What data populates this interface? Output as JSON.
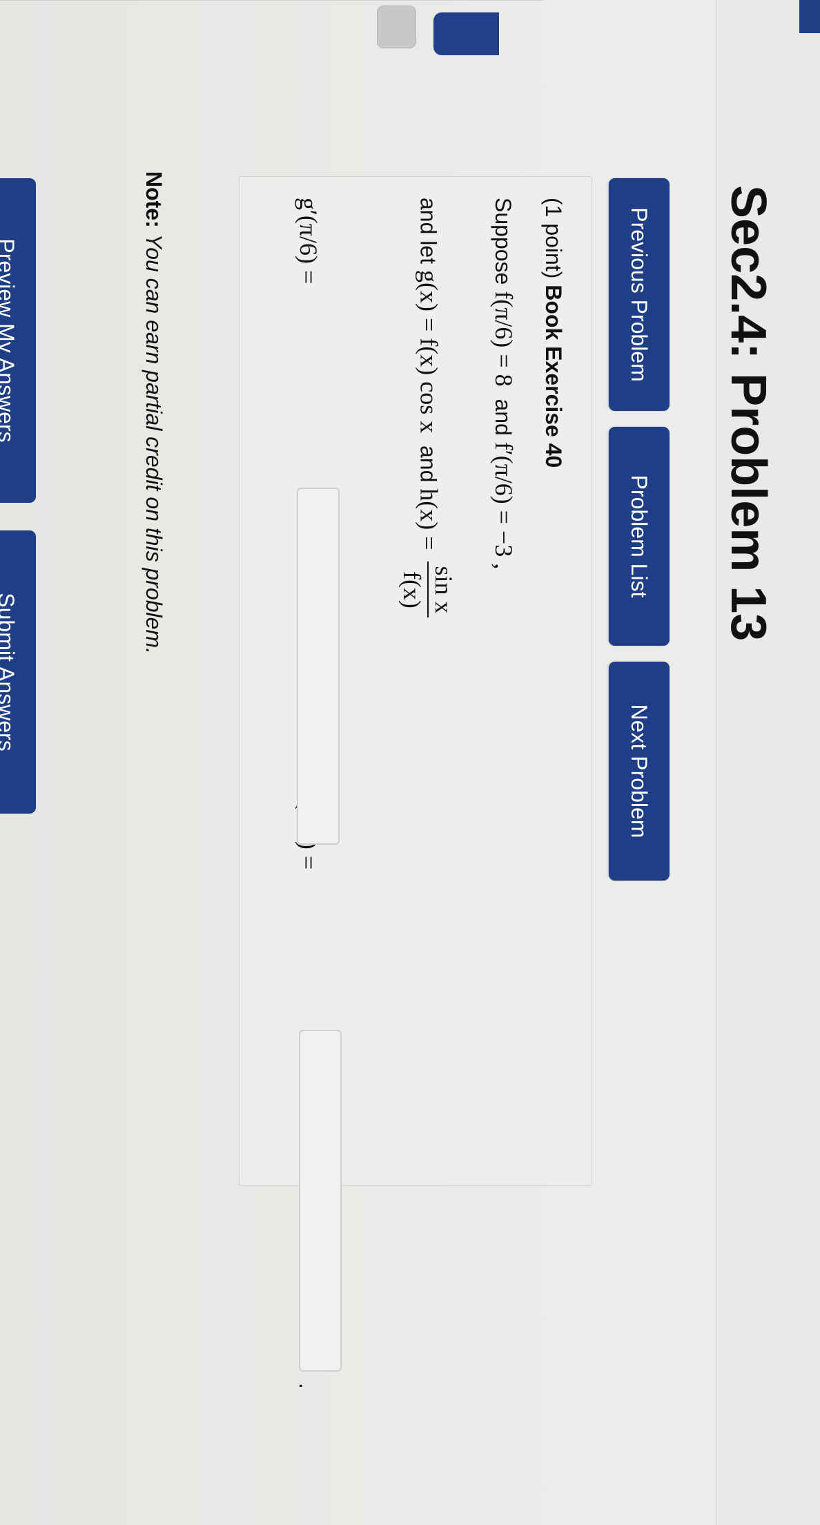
{
  "page": {
    "title": "Sec2.4: Problem 13"
  },
  "nav": {
    "previous_label": "Previous Problem",
    "list_label": "Problem List",
    "next_label": "Next Problem"
  },
  "problem": {
    "points": "(1 point)",
    "exercise_title": "Book Exercise 40",
    "suppose_word": "Suppose",
    "given_1": "f(π/6) = 8",
    "and_word": "and",
    "given_2": "f′(π/6) = −3 ,",
    "let_prefix": "and let",
    "g_definition": "g(x) = f(x) cos x",
    "h_prefix": "h(x) =",
    "h_numerator": "sin x",
    "h_denominator": "f(x)",
    "g_prime_prompt": "g′(π/6) =",
    "g_prime_value": "",
    "h_prime_prompt": "h′(π/6) =",
    "h_prime_value": "",
    "period": "."
  },
  "note": {
    "bold": "Note:",
    "text": "You can earn partial credit on this problem."
  },
  "actions": {
    "preview_label": "Preview My Answers",
    "submit_label": "Submit Answers"
  },
  "colors": {
    "button_blue": "#1e3f86",
    "button_text": "#ffffff",
    "page_background": "#ebebe9",
    "problem_box": "#eeeeed"
  }
}
